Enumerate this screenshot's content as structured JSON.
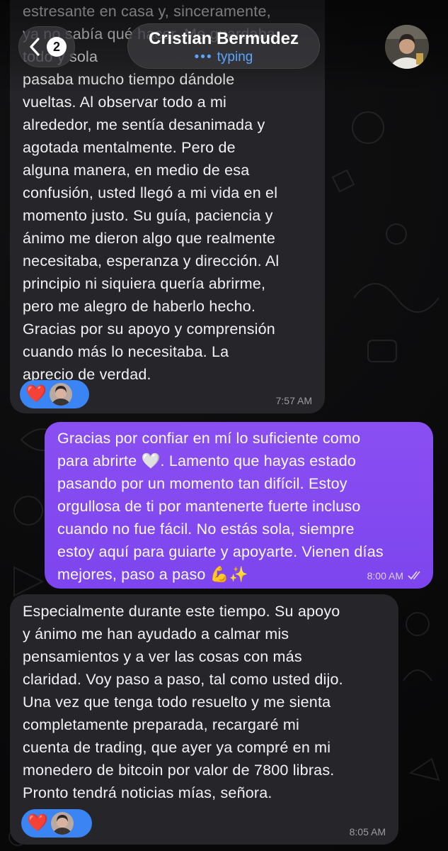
{
  "header": {
    "back_count": "2",
    "contact_name": "Cristian Bermudez",
    "status_dots": "•••",
    "status": "typing"
  },
  "messages": [
    {
      "direction": "incoming",
      "text": "estresante en casa y, sinceramente,\nya no sabía qué hacer. Me guardaba\ntodo y sola\npasaba mucho tiempo dándole\nvueltas. Al observar todo a mi\nalrededor, me sentía desanimada y\nagotada mentalmente. Pero de\nalguna manera, en medio de esa\nconfusión, usted llegó a mi vida en el\nmomento justo. Su guía, paciencia y\nánimo me dieron algo que realmente\nnecesitaba, esperanza y dirección. Al\nprincipio ni siquiera quería abrirme,\npero me alegro de haberlo hecho.\nGracias por su apoyo y comprensión\ncuando más lo necesitaba. La\naprecio de verdad.",
      "reaction": "❤️",
      "time": "7:57 AM"
    },
    {
      "direction": "outgoing",
      "text": "Gracias por confiar en mí lo suficiente como\npara abrirte 🤍. Lamento que hayas estado\npasando por un momento tan difícil. Estoy\norgullosa de ti por mantenerte fuerte incluso\ncuando no fue fácil. No estás sola, siempre\nestoy aquí para guiarte y apoyarte. Vienen días\nmejores, paso a paso 💪✨",
      "time": "8:00 AM",
      "read_icon": "double-check-icon"
    },
    {
      "direction": "incoming",
      "text": "Especialmente durante este tiempo. Su apoyo\ny ánimo me han ayudado a calmar mis\npensamientos y a ver las cosas con más\nclaridad. Voy paso a paso, tal como usted dijo.\nUna vez que tenga todo resuelto y me sienta\ncompletamente preparada, recargaré mi\ncuenta de trading, que ayer ya compré en mi\nmonedero de bitcoin por valor de 7800 libras.\nPronto tendrá noticias mías, señora.",
      "reaction": "❤️",
      "time": "8:05 AM"
    }
  ],
  "colors": {
    "incoming_bubble": "#262529",
    "outgoing_bubble": "#8a4ff2",
    "reaction_pill": "#3b84f4",
    "status_blue": "#5aa6ff"
  }
}
